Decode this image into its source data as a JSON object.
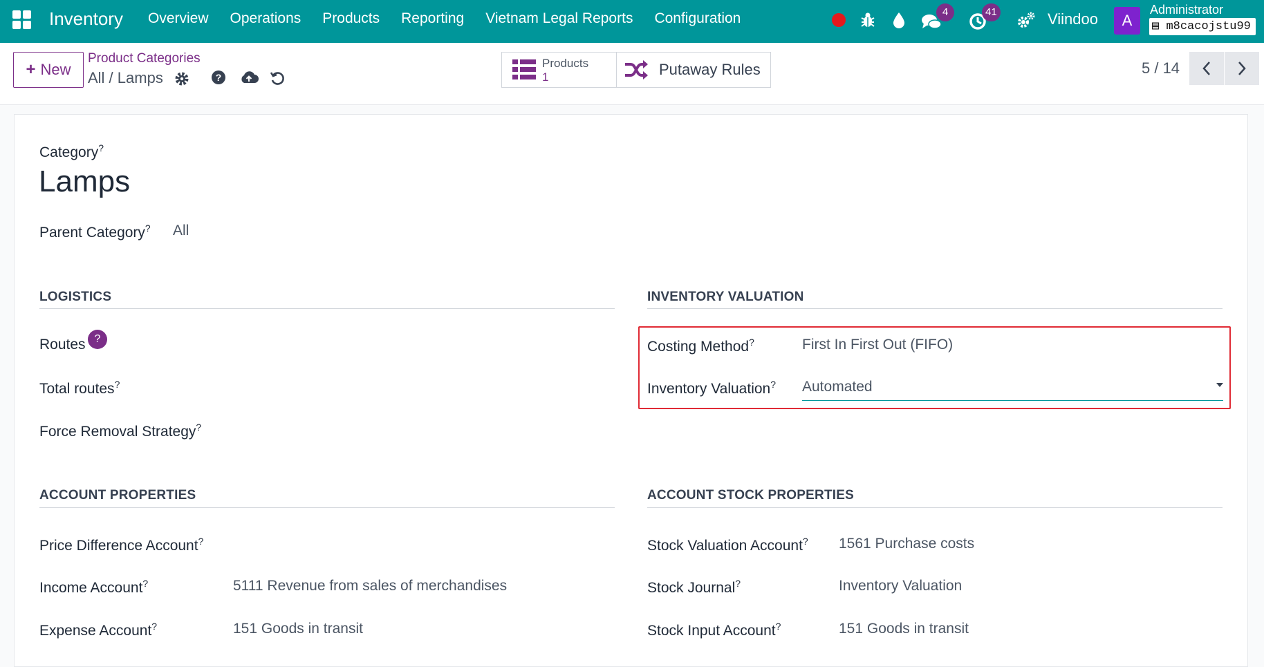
{
  "navbar": {
    "app_title": "Inventory",
    "menu": [
      "Overview",
      "Operations",
      "Products",
      "Reporting",
      "Vietnam Legal Reports",
      "Configuration"
    ],
    "chat_count": "4",
    "activity_count": "41",
    "company": "Viindoo",
    "avatar_letter": "A",
    "user_name": "Administrator",
    "database": "m8cacojstu99",
    "accent": "#00969a"
  },
  "control": {
    "new_label": "New",
    "breadcrumb_parent": "Product Categories",
    "breadcrumb_current": "All / Lamps",
    "stat_products_label": "Products",
    "stat_products_value": "1",
    "stat_putaway_label": "Putaway Rules",
    "pager": "5 / 14"
  },
  "form": {
    "category_label": "Category",
    "category_name": "Lamps",
    "parent_label": "Parent Category",
    "parent_value": "All",
    "logistics": {
      "title": "LOGISTICS",
      "routes_label": "Routes",
      "routes_help": "?",
      "total_routes_label": "Total routes",
      "removal_label": "Force Removal Strategy"
    },
    "valuation": {
      "title": "INVENTORY VALUATION",
      "costing_label": "Costing Method",
      "costing_value": "First In First Out (FIFO)",
      "valuation_label": "Inventory Valuation",
      "valuation_value": "Automated"
    },
    "account": {
      "title": "ACCOUNT PROPERTIES",
      "price_diff_label": "Price Difference Account",
      "income_label": "Income Account",
      "income_value": "5111 Revenue from sales of merchandises",
      "expense_label": "Expense Account",
      "expense_value": "151 Goods in transit"
    },
    "stock": {
      "title": "ACCOUNT STOCK PROPERTIES",
      "valuation_account_label": "Stock Valuation Account",
      "valuation_account_value": "1561 Purchase costs",
      "journal_label": "Stock Journal",
      "journal_value": "Inventory Valuation",
      "input_label": "Stock Input Account",
      "input_value": "151 Goods in transit"
    },
    "help_mark": "?"
  }
}
